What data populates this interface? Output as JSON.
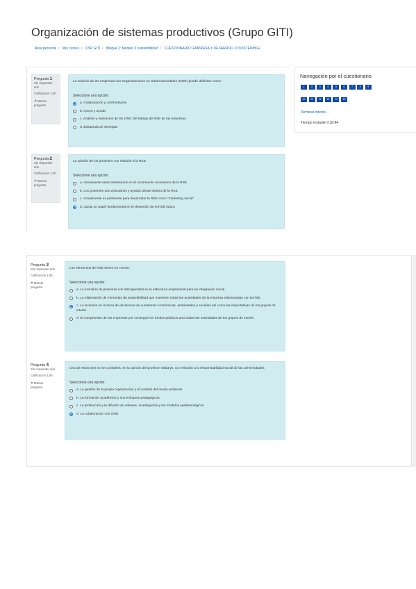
{
  "page": {
    "title": "Organización de sistemas productivos (Grupo GITI)",
    "breadcrumb": [
      "Área personal",
      "Mis cursos",
      "OSP GITI",
      "Bloque 2: Modelo 3 sostenibilidad",
      "CUESTIONARIO: EMPRESA Y DESARROLLO SOSTENIBLE"
    ]
  },
  "navigation": {
    "title": "Navegación por el cuestionario",
    "row1": [
      "1",
      "2",
      "3",
      "4",
      "5",
      "6",
      "7",
      "8",
      "9"
    ],
    "row2": [
      "10",
      "11",
      "12",
      "13",
      "14",
      "15"
    ],
    "finish_link": "Terminar intento...",
    "time_left": "Tiempo restante 0:18:44"
  },
  "questions": [
    {
      "number": "1",
      "label": "Pregunta",
      "status": "Sin responder aún",
      "score": "Calificación 1,00",
      "flag_label": "Marcar pregunta",
      "text": "La relación de las empresas con Organizaciones no Gubernamentales (ONG) puede definirse como:",
      "prompt": "Seleccione una opción:",
      "options": [
        {
          "text": "a. Colaboración y confrontación",
          "checked": true
        },
        {
          "text": "b. Apoyo y ayuda",
          "checked": false
        },
        {
          "text": "c. Análisis y valoración de las ONG del trabajo de RSE de las empresas",
          "checked": false
        },
        {
          "text": "d. Búsqueda de sinergias",
          "checked": false
        }
      ]
    },
    {
      "number": "2",
      "label": "Pregunta",
      "status": "Sin responder aún",
      "score": "Calificación 1,00",
      "flag_label": "Marcar pregunta",
      "text": "La opinión de los ponentes con relación a la RSE:",
      "prompt": "Seleccione una opción:",
      "options": [
        {
          "text": "a. Únicamente estar interesados en el crecimiento económico de la RSE",
          "checked": false
        },
        {
          "text": "b. Los ponentes son voluntarios y ayudan desde dentro de la RSE",
          "checked": false
        },
        {
          "text": "c. Actualmente es pertinente para desarrollar la RSE como \"marketing social\"",
          "checked": false
        },
        {
          "text": "d. Juega un papel fundamental en el desarrollo de la RSE futura",
          "checked": true
        }
      ]
    },
    {
      "number": "3",
      "label": "Pregunta",
      "status": "Sin responder aún",
      "score": "Calificación 1,00",
      "flag_label": "Marcar pregunta",
      "text": "Los elementos de RSE tienen en común:",
      "prompt": "Seleccione una opción:",
      "options": [
        {
          "text": "a. La inclusión de personas con discapacidad en la estructura empresarial para su integración social",
          "checked": false
        },
        {
          "text": "b. La elaboración de memorias de sostenibilidad que muestren todas las actividades de la empresa relacionadas con la RSE",
          "checked": false
        },
        {
          "text": "c. La inclusión en la toma de decisiones de cuestiones económicas, ambientales y sociales así como las expectativas de los grupos de interés",
          "checked": true
        },
        {
          "text": "d. El compromiso de las empresas por conseguir los fondos públicos para todas las actividades de los grupos de interés",
          "checked": false
        }
      ]
    },
    {
      "number": "4",
      "label": "Pregunta",
      "status": "Sin responder aún",
      "score": "Calificación 1,00",
      "flag_label": "Marcar pregunta",
      "text": "Uno de estos ejes no se considera, en la opinión del profesor Vallaeys, con relación a la responsabilidad social de las universidades:",
      "prompt": "Seleccione una opción:",
      "options": [
        {
          "text": "a. La gestión de la propia organización y el cuidado del medio ambiente",
          "checked": false
        },
        {
          "text": "b. La formación académica y sus enfoques pedagógicos",
          "checked": false
        },
        {
          "text": "c. La producción y la difusión de saberes, investigación y los modelos epistemológicos",
          "checked": false
        },
        {
          "text": "d. La colaboración con ONG",
          "checked": true
        }
      ]
    }
  ]
}
